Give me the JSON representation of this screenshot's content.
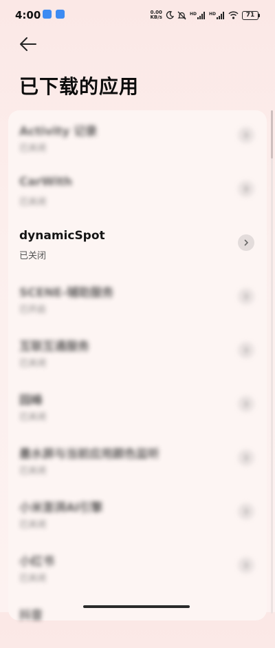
{
  "status_bar": {
    "time": "4:00",
    "net_speed_value": "0.00",
    "net_speed_unit": "KB/s",
    "hd_label": "HD",
    "battery": "71",
    "icons": [
      "app-notification-icon",
      "app-notification-icon",
      "moon-icon",
      "silent-icon",
      "signal-icon",
      "signal-icon",
      "wifi-icon",
      "battery-icon"
    ]
  },
  "header": {
    "back_icon": "arrow-left-icon",
    "title": "已下载的应用"
  },
  "apps": [
    {
      "name": "Activity 记录",
      "status": "已关闭",
      "blurred": true
    },
    {
      "name": "CarWith",
      "status": "已关闭",
      "blurred": true
    },
    {
      "name": "dynamicSpot",
      "status": "已关闭",
      "blurred": false
    },
    {
      "name": "SCENE-辅助服务",
      "status": "已开启",
      "blurred": true
    },
    {
      "name": "互联互通服务",
      "status": "已关闭",
      "blurred": true
    },
    {
      "name": "园峰",
      "status": "已关闭",
      "blurred": true
    },
    {
      "name": "墨水屏与当前应用颜色监听",
      "status": "已关闭",
      "blurred": true
    },
    {
      "name": "小米澎湃AI引擎",
      "status": "已关闭",
      "blurred": true
    },
    {
      "name": "小红书",
      "status": "已关闭",
      "blurred": true
    },
    {
      "name": "抖音",
      "status": "",
      "blurred": true
    }
  ]
}
